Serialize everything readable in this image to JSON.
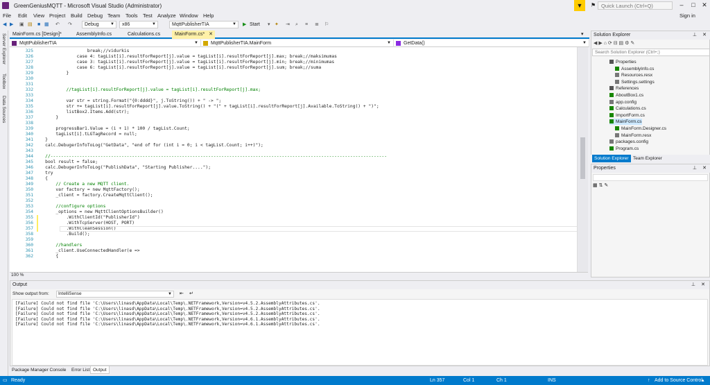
{
  "window": {
    "title": "GreenGeniusMQTT - Microsoft Visual Studio  (Administrator)",
    "quick_launch_placeholder": "Quick Launch (Ctrl+Q)",
    "sign_in": "Sign in"
  },
  "menu": [
    "File",
    "Edit",
    "View",
    "Project",
    "Build",
    "Debug",
    "Team",
    "Tools",
    "Test",
    "Analyze",
    "Window",
    "Help"
  ],
  "toolbar": {
    "config": "Debug",
    "platform": "x86",
    "startup_project": "MqttPublisherTIA",
    "start_label": "Start"
  },
  "left_strip": [
    "Server Explorer",
    "Toolbox",
    "Data Sources"
  ],
  "doc_tabs": [
    {
      "label": "MainForm.cs [Design]*",
      "active": false
    },
    {
      "label": "AssemblyInfo.cs",
      "active": false
    },
    {
      "label": "Calculations.cs",
      "active": false
    },
    {
      "label": "MainForm.cs*",
      "active": true
    }
  ],
  "navbar": {
    "project": "MqttPublisherTIA",
    "class": "MqttPublisherTIA.MainForm",
    "member": "GetData()"
  },
  "editor": {
    "zoom": "100 %",
    "lines": [
      {
        "n": "325",
        "t": "                    break;//vidurkis"
      },
      {
        "n": "326",
        "t": "                case 4: tagList[i].resultForReport[j].value = tagList[i].resultForReport[j].max; break;//maksimumas"
      },
      {
        "n": "327",
        "t": "                case 3: tagList[i].resultForReport[j].value = tagList[i].resultForReport[j].min; break;//minimumas"
      },
      {
        "n": "328",
        "t": "                case 6: tagList[i].resultForReport[j].value = tagList[i].resultForReport[j].sum; break;//suma"
      },
      {
        "n": "329",
        "t": "            }"
      },
      {
        "n": "330",
        "t": ""
      },
      {
        "n": "331",
        "t": ""
      },
      {
        "n": "332",
        "t": "            //tagList[i].resultForReport[j].value = tagList[i].resultForReport[j].max;"
      },
      {
        "n": "333",
        "t": ""
      },
      {
        "n": "334",
        "t": "            var str = string.Format(\"{0:dddd}\", j.ToString()) + \" -> \";"
      },
      {
        "n": "335",
        "t": "            str += tagList[i].resultForReport[j].value.ToString() + \"(\" + tagList[i].resultForReport[j].Available.ToString() + \")\";"
      },
      {
        "n": "336",
        "t": "            listBox2.Items.Add(str);"
      },
      {
        "n": "337",
        "t": "        }"
      },
      {
        "n": "338",
        "t": ""
      },
      {
        "n": "339",
        "t": "        progressBar1.Value = (i + 1) * 100 / tagList.Count;"
      },
      {
        "n": "340",
        "t": "        tagList[i].tLGTagRecord = null;"
      },
      {
        "n": "341",
        "t": "    }"
      },
      {
        "n": "342",
        "t": "    calc.DebugerInfoToLog(\"GetData\", \"end of for (int i = 0; i < tagList.Count; i++)\");"
      },
      {
        "n": "343",
        "t": ""
      },
      {
        "n": "344",
        "t": "    //--------------------------------------------------------------------------------------------------------------------------------"
      },
      {
        "n": "345",
        "t": "    bool result = false;"
      },
      {
        "n": "346",
        "t": "    calc.DebugerInfoToLog(\"PublishData\", \"Starting Publisher....\");"
      },
      {
        "n": "347",
        "t": "    try"
      },
      {
        "n": "348",
        "t": "    {"
      },
      {
        "n": "349",
        "t": "        // Create a new MQTT client."
      },
      {
        "n": "350",
        "t": "        var factory = new MqttFactory();"
      },
      {
        "n": "351",
        "t": "        _client = factory.CreateMqttClient();"
      },
      {
        "n": "352",
        "t": ""
      },
      {
        "n": "353",
        "t": "        //configure options"
      },
      {
        "n": "354",
        "t": "        _options = new MqttClientOptionsBuilder()"
      },
      {
        "n": "355",
        "t": "            .WithClientId(\"PublisherId\")"
      },
      {
        "n": "356",
        "t": "            .WithTcpServer(HOST, PORT)"
      },
      {
        "n": "357",
        "t": "            .WithCleanSession()"
      },
      {
        "n": "358",
        "t": "            .Build();"
      },
      {
        "n": "359",
        "t": ""
      },
      {
        "n": "360",
        "t": "        //handlers"
      },
      {
        "n": "361",
        "t": "        _client.UseConnectedHandler(e =>"
      },
      {
        "n": "362",
        "t": "        {"
      }
    ]
  },
  "solution_explorer": {
    "title": "Solution Explorer",
    "search_placeholder": "Search Solution Explorer (Ctrl+;)",
    "items": [
      {
        "label": "Properties",
        "indent": 2,
        "color": "#555"
      },
      {
        "label": "AssemblyInfo.cs",
        "indent": 3,
        "color": "#178600"
      },
      {
        "label": "Resources.resx",
        "indent": 3,
        "color": "#777"
      },
      {
        "label": "Settings.settings",
        "indent": 3,
        "color": "#777"
      },
      {
        "label": "References",
        "indent": 2,
        "color": "#555"
      },
      {
        "label": "AboutBox1.cs",
        "indent": 2,
        "color": "#178600"
      },
      {
        "label": "app.config",
        "indent": 2,
        "color": "#777"
      },
      {
        "label": "Calculations.cs",
        "indent": 2,
        "color": "#178600"
      },
      {
        "label": "ImportForm.cs",
        "indent": 2,
        "color": "#178600"
      },
      {
        "label": "MainForm.cs",
        "indent": 2,
        "color": "#178600",
        "selected": true
      },
      {
        "label": "MainForm.Designer.cs",
        "indent": 3,
        "color": "#178600"
      },
      {
        "label": "MainForm.resx",
        "indent": 3,
        "color": "#777"
      },
      {
        "label": "packages.config",
        "indent": 2,
        "color": "#777"
      },
      {
        "label": "Program.cs",
        "indent": 2,
        "color": "#178600"
      }
    ],
    "tabs": [
      "Solution Explorer",
      "Team Explorer"
    ]
  },
  "properties": {
    "title": "Properties"
  },
  "output": {
    "title": "Output",
    "show_from_label": "Show output from:",
    "source": "IntelliSense",
    "lines": [
      "[Failure] Could not find file 'C:\\Users\\linasd\\AppData\\Local\\Temp\\.NETFramework,Version=v4.5.2.AssemblyAttributes.cs'.",
      "[Failure] Could not find file 'C:\\Users\\linasd\\AppData\\Local\\Temp\\.NETFramework,Version=v4.5.2.AssemblyAttributes.cs'.",
      "[Failure] Could not find file 'C:\\Users\\linasd\\AppData\\Local\\Temp\\.NETFramework,Version=v4.5.2.AssemblyAttributes.cs'.",
      "[Failure] Could not find file 'C:\\Users\\linasd\\AppData\\Local\\Temp\\.NETFramework,Version=v4.6.1.AssemblyAttributes.cs'.",
      "[Failure] Could not find file 'C:\\Users\\linasd\\AppData\\Local\\Temp\\.NETFramework,Version=v4.6.1.AssemblyAttributes.cs'."
    ]
  },
  "bottom_tabs": [
    {
      "label": "Package Manager Console",
      "active": false
    },
    {
      "label": "Error List",
      "active": false
    },
    {
      "label": "Output",
      "active": true
    }
  ],
  "status": {
    "state": "Ready",
    "ln": "Ln 357",
    "col": "Col 1",
    "ch": "Ch 1",
    "ins": "INS",
    "source_control": "Add to Source Control"
  }
}
